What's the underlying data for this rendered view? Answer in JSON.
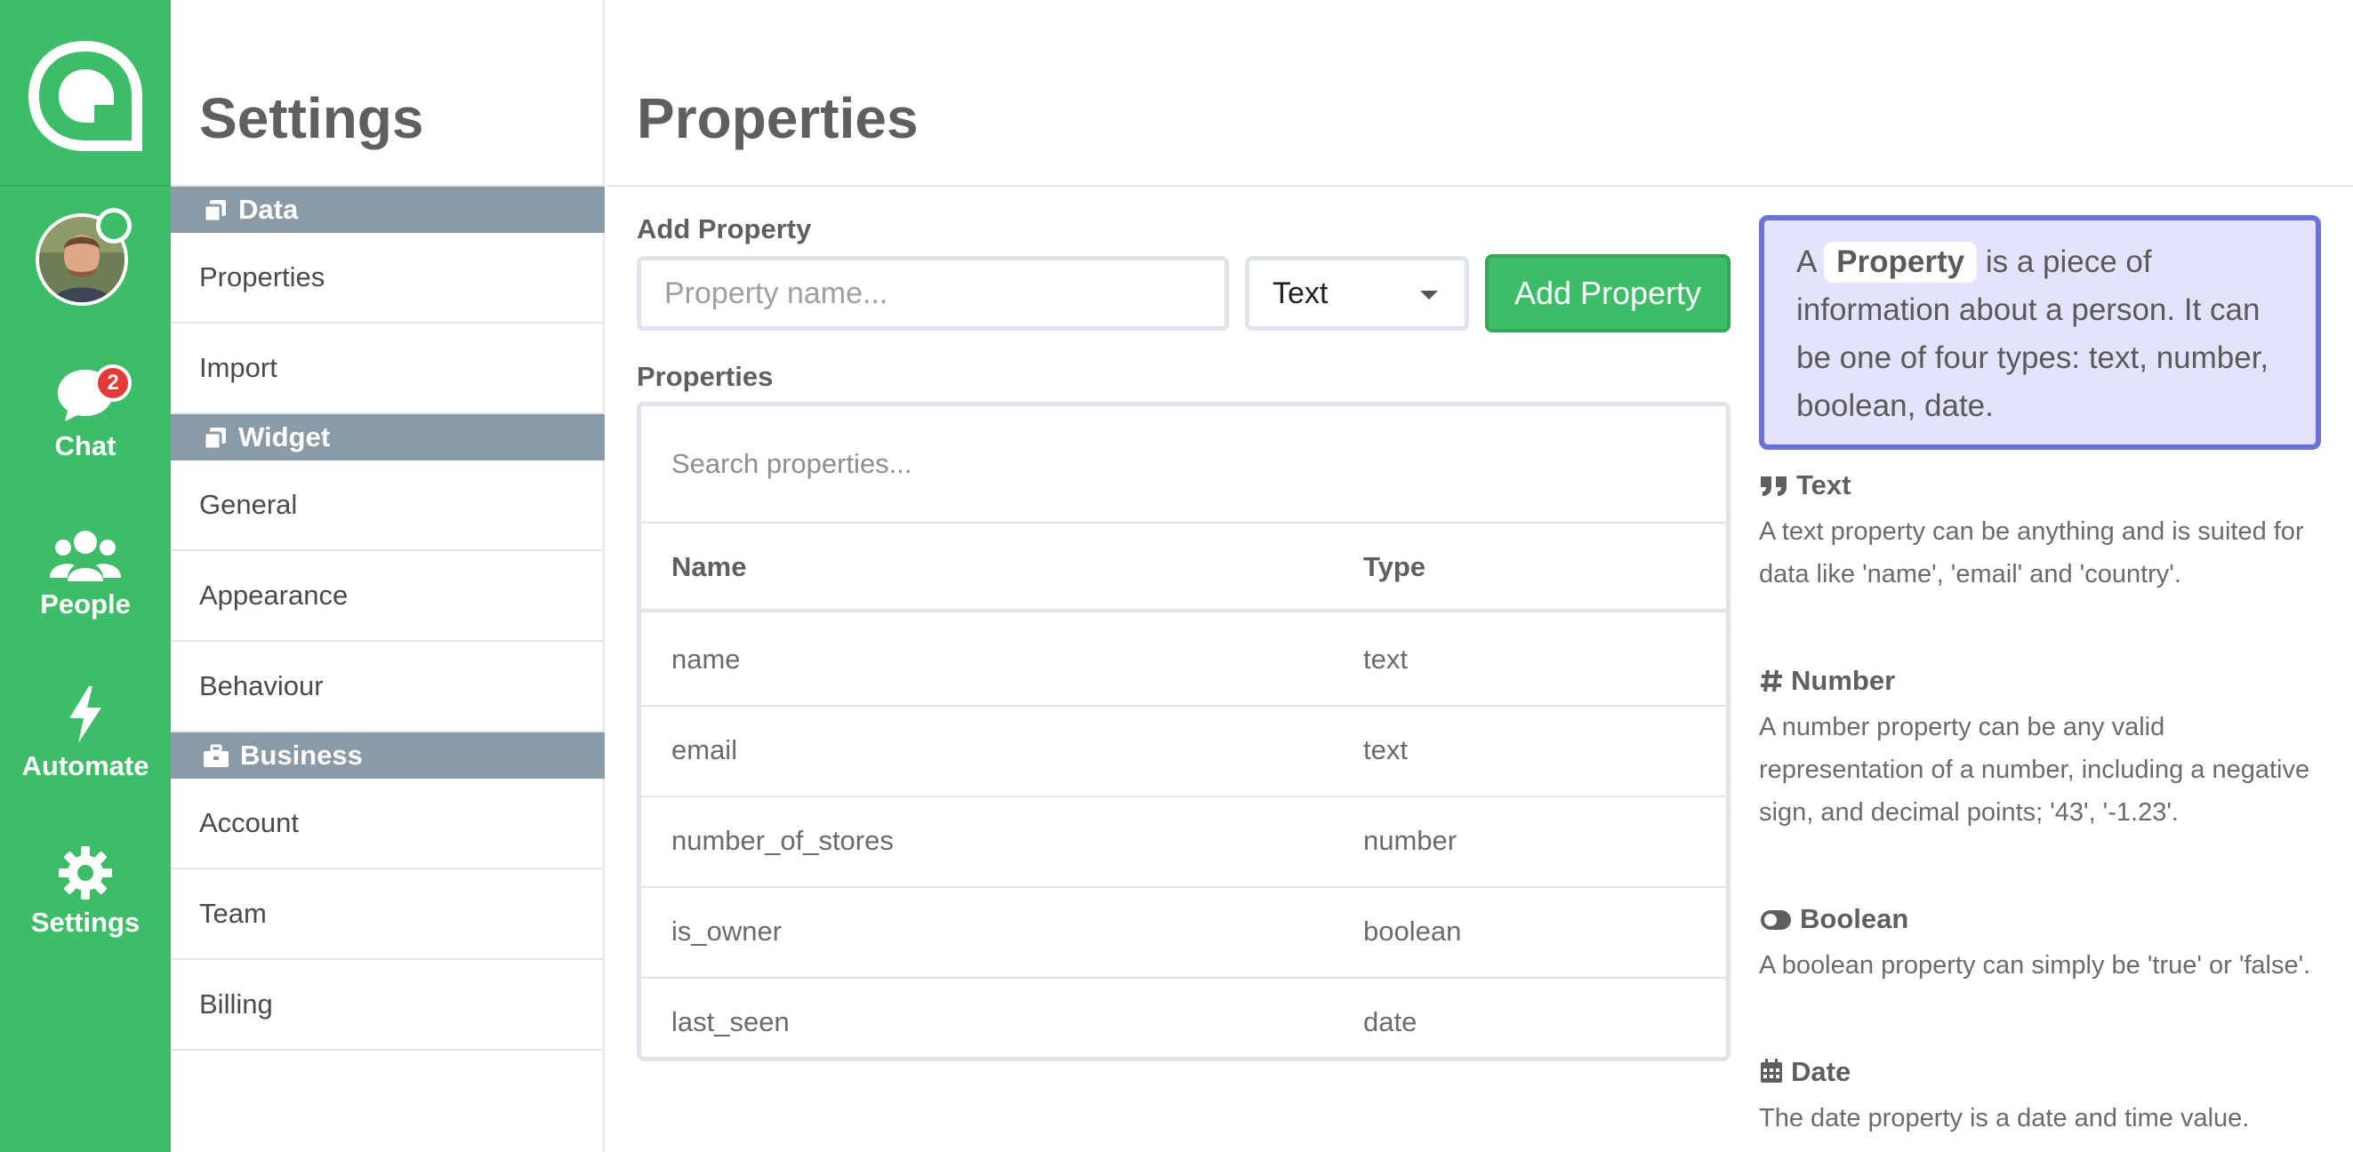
{
  "rail": {
    "items": [
      {
        "label": "Chat",
        "icon": "chat-icon",
        "badge": "2"
      },
      {
        "label": "People",
        "icon": "people-icon"
      },
      {
        "label": "Automate",
        "icon": "lightning-icon"
      },
      {
        "label": "Settings",
        "icon": "gear-icon"
      }
    ]
  },
  "settings_nav": {
    "title": "Settings",
    "sections": [
      {
        "label": "Data",
        "icon": "copy-icon",
        "items": [
          "Properties",
          "Import"
        ]
      },
      {
        "label": "Widget",
        "icon": "copy-icon",
        "items": [
          "General",
          "Appearance",
          "Behaviour"
        ]
      },
      {
        "label": "Business",
        "icon": "briefcase-icon",
        "items": [
          "Account",
          "Team",
          "Billing"
        ]
      }
    ]
  },
  "main": {
    "title": "Properties",
    "add_label": "Add Property",
    "name_placeholder": "Property name...",
    "type_value": "Text",
    "add_button": "Add Property",
    "list_label": "Properties",
    "search_placeholder": "Search properties...",
    "columns": [
      "Name",
      "Type"
    ],
    "rows": [
      {
        "name": "name",
        "type": "text"
      },
      {
        "name": "email",
        "type": "text"
      },
      {
        "name": "number_of_stores",
        "type": "number"
      },
      {
        "name": "is_owner",
        "type": "boolean"
      },
      {
        "name": "last_seen",
        "type": "date"
      }
    ]
  },
  "help": {
    "intro_prefix": "A",
    "intro_term": "Property",
    "intro_rest": "is a piece of information about a person. It can be one of four types: text, number, boolean, date.",
    "types": [
      {
        "title": "Text",
        "icon": "quote-icon",
        "text": "A text property can be anything and is suited for data like 'name', 'email' and 'country'."
      },
      {
        "title": "Number",
        "icon": "hash-icon",
        "text": "A number property can be any valid representation of a number, including a negative sign, and decimal points; '43', '-1.23'."
      },
      {
        "title": "Boolean",
        "icon": "toggle-icon",
        "text": "A boolean property can simply be 'true' or 'false'."
      },
      {
        "title": "Date",
        "icon": "calendar-icon",
        "text": "The date property is a date and time value."
      }
    ]
  },
  "colors": {
    "brand_green": "#3dbd68",
    "section_gray": "#8a9aa6",
    "callout_bg": "#e3e3fb",
    "callout_border": "#6a72d8",
    "badge_red": "#e53935"
  }
}
